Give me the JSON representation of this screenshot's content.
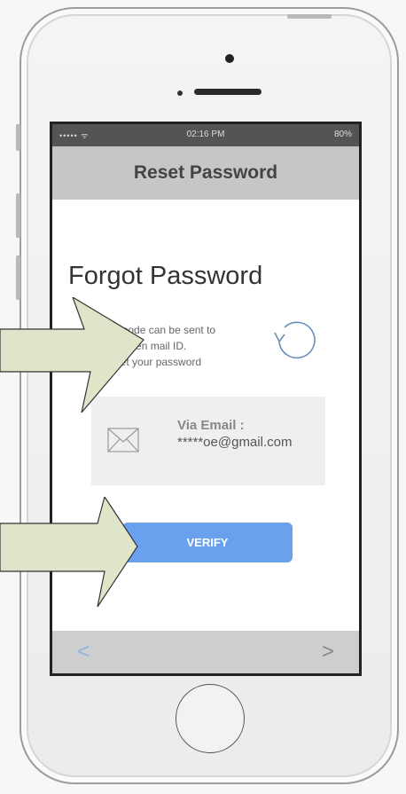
{
  "status_bar": {
    "signal": "••••• ᯤ",
    "time": "02:16 PM",
    "battery": "80%"
  },
  "header": {
    "title": "Reset Password"
  },
  "main": {
    "heading": "Forgot Password",
    "info_lines": [
      "4 digit code can be sent to",
      "below given mail ID.",
      "To reset your password"
    ],
    "email_card": {
      "label": "Via Email :",
      "value": "*****oe@gmail.com"
    },
    "verify_label": "VERIFY"
  },
  "bottom_bar": {
    "prev_label": "<",
    "next_label": ">"
  },
  "icons": {
    "reload": "reload-icon",
    "mail": "mail-icon",
    "arrows": "arrow-pointer"
  },
  "colors": {
    "accent": "#6aa1ee",
    "header": "#c6c6c6",
    "arrow_fill": "#dfe5c8"
  }
}
